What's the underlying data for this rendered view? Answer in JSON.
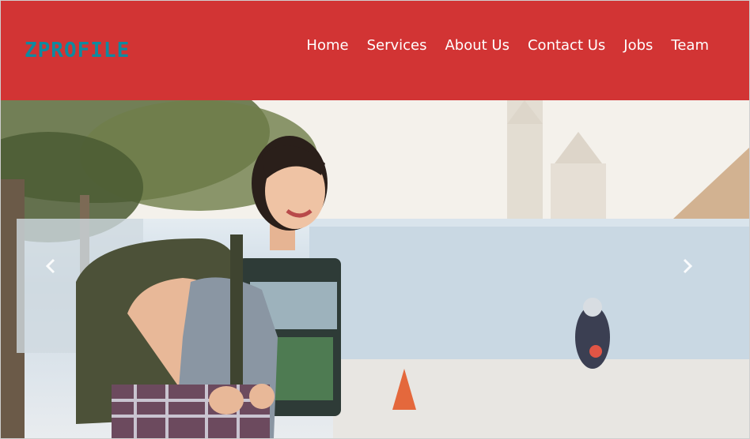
{
  "brand": {
    "logo_text": "ZPROFILE",
    "color": "#0f8aa0"
  },
  "nav": {
    "items": [
      {
        "label": "Home"
      },
      {
        "label": "Services"
      },
      {
        "label": "About Us"
      },
      {
        "label": "Contact Us"
      },
      {
        "label": "Jobs"
      },
      {
        "label": "Team"
      }
    ],
    "background": "#d23434"
  },
  "carousel": {
    "prev_icon": "chevron-left-icon",
    "next_icon": "chevron-right-icon"
  }
}
